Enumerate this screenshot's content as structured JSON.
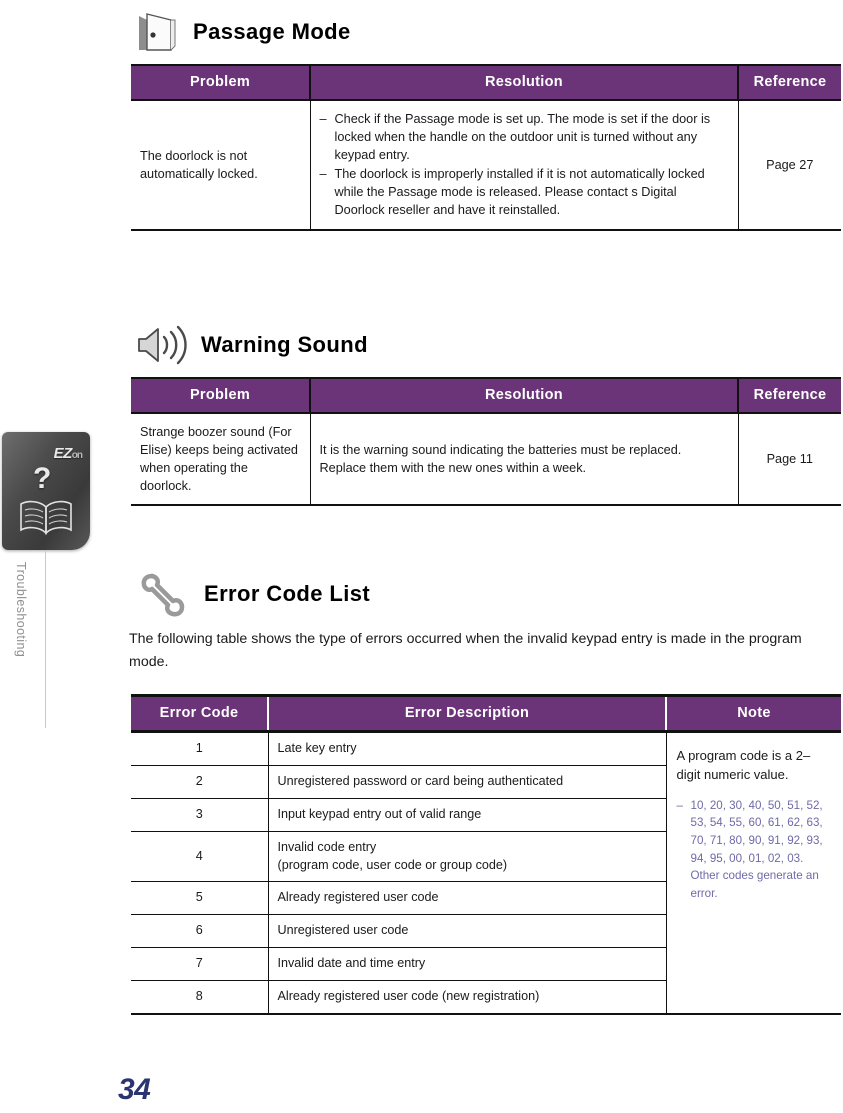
{
  "page": {
    "number": "34",
    "accent_purple": "#6B3478",
    "note_text_color": "#6F6AA8",
    "page_number_color": "#2A3470"
  },
  "sidebar": {
    "brand": "EZ",
    "brand_suffix": "on",
    "question_mark": "?",
    "label": "Troubleshooting",
    "icons": [
      "question-mark",
      "open-book"
    ]
  },
  "sections": [
    {
      "id": "passage-mode",
      "title": "Passage Mode",
      "icon": "open-door-icon",
      "table": {
        "headers": [
          "Problem",
          "Resolution",
          "Reference"
        ],
        "rows": [
          {
            "problem": "The doorlock is not automatically locked.",
            "resolution_items": [
              "Check if the Passage mode is set up. The mode is set if the door is locked when the handle on the outdoor unit is turned without any keypad entry.",
              "The doorlock is improperly installed if it is not automatically locked while the Passage mode is released.   Please contact s Digital Doorlock reseller and have it reinstalled."
            ],
            "reference": "Page 27"
          }
        ]
      }
    },
    {
      "id": "warning-sound",
      "title": "Warning Sound",
      "icon": "speaker-sound-icon",
      "table": {
        "headers": [
          "Problem",
          "Resolution",
          "Reference"
        ],
        "rows": [
          {
            "problem": "Strange boozer sound (For Elise) keeps being activated when operating the doorlock.",
            "resolution": "It is the warning sound indicating the batteries must be replaced. Replace them with the new ones within a week.",
            "reference": "Page 11"
          }
        ]
      }
    },
    {
      "id": "error-code-list",
      "title": "Error Code List",
      "icon": "wrench-icon",
      "intro": "The following table shows the type of errors occurred when the invalid keypad entry is made in the program mode.",
      "table": {
        "headers": [
          "Error Code",
          "Error Description",
          "Note"
        ],
        "rows": [
          {
            "code": "1",
            "description": "Late key entry"
          },
          {
            "code": "2",
            "description": "Unregistered password or card being authenticated"
          },
          {
            "code": "3",
            "description": "Input keypad entry out of valid range"
          },
          {
            "code": "4",
            "description": "Invalid code entry\n(program code, user code or group code)"
          },
          {
            "code": "5",
            "description": "Already registered user code"
          },
          {
            "code": "6",
            "description": "Unregistered user code"
          },
          {
            "code": "7",
            "description": "Invalid date and time entry"
          },
          {
            "code": "8",
            "description": "Already registered user code (new registration)"
          }
        ],
        "note": {
          "lead": "A program code is a 2–digit numeric value.",
          "codes": "10, 20, 30, 40, 50, 51, 52, 53, 54, 55, 60, 61, 62, 63, 70, 71, 80, 90, 91, 92, 93, 94, 95, 00, 01, 02, 03.   Other codes generate an error."
        }
      }
    }
  ]
}
